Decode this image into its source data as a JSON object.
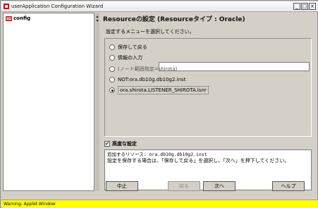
{
  "window": {
    "title": "userApplication Configuration Wizard",
    "controls": [
      "_",
      "□",
      "×"
    ]
  },
  "tree": {
    "root_label": "config",
    "root_icon": "folder-config-icon"
  },
  "panel": {
    "title": "Resourceの設定 (Resourceタイプ : Oracle)",
    "instruction": "設定するメニューを選択してください。",
    "options": [
      {
        "label": "保存して戻る",
        "selected": false,
        "disabled": false
      },
      {
        "label": "情報の入力",
        "selected": false,
        "disabled": false
      },
      {
        "label": "(ノード範囲指定=shirota)",
        "selected": false,
        "disabled": true
      },
      {
        "label": "NOT:ora.db10g.db10g2.inst",
        "selected": false,
        "disabled": false
      },
      {
        "label": "ora.shirota.LISTENER_SHIROTA.lsnr",
        "selected": true,
        "disabled": false
      }
    ],
    "input_value": "",
    "advanced_label": "高度な設定",
    "advanced_checked": true,
    "info_lines": [
      "追加するリソース: ora.db10g.db10g2.inst",
      "設定を保存する場合は、「保存して戻る」を選択し、「次へ」を押下してください。"
    ]
  },
  "buttons": {
    "cancel": "中止",
    "back": "戻る",
    "next": "次へ",
    "help": "ヘルプ"
  },
  "status": {
    "warning": "Warning: Applet Window"
  },
  "colors": {
    "window_bg": "#d4d0c8",
    "warning_bg": "#ffff00"
  }
}
